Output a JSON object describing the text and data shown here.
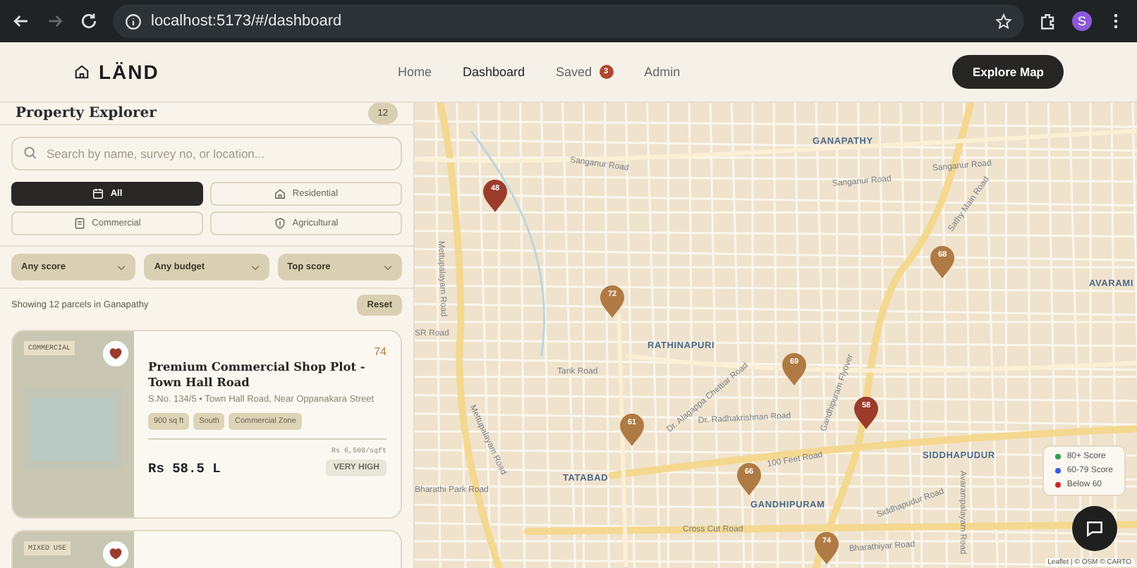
{
  "browser": {
    "url": "localhost:5173/#/dashboard",
    "forward_disabled": true,
    "profile_initial": "S"
  },
  "navbar": {
    "brand": "LÄND",
    "links": [
      {
        "label": "Home",
        "selected": false
      },
      {
        "label": "Dashboard",
        "selected": true
      },
      {
        "label": "Saved",
        "selected": false,
        "badge": "3"
      },
      {
        "label": "Admin",
        "selected": false
      }
    ],
    "cta": "Explore Map"
  },
  "sidebar": {
    "title": "Property Explorer",
    "count": "12",
    "search": {
      "placeholder": "Search by name, survey no, or location..."
    },
    "type_filters": [
      {
        "label": "All",
        "selected": true
      },
      {
        "label": "Residential",
        "selected": false
      },
      {
        "label": "Commercial",
        "selected": false
      },
      {
        "label": "Agricultural",
        "selected": false
      }
    ],
    "dropdowns": [
      "Any score",
      "Any budget",
      "Top score"
    ],
    "summary": "Showing 12 parcels in Ganapathy",
    "reset": "Reset",
    "cards": [
      {
        "tag": "COMMERCIAL",
        "saved": true,
        "score": "74",
        "title": "Premium Commercial Shop Plot - Town Hall Road",
        "address": "S.No. 134/5 • Town Hall Road, Near Oppanakara Street",
        "chips": [
          "900 sq ft",
          "South",
          "Commercial Zone"
        ],
        "rate": "Rs 6,500/sqft",
        "price": "Rs 58.5 L",
        "demand": "VERY HIGH"
      },
      {
        "tag": "MIXED USE",
        "saved": true
      }
    ]
  },
  "map": {
    "labels": [
      {
        "text": "GANAPATHY",
        "kind": "area"
      },
      {
        "text": "Sanganur Road",
        "kind": "road"
      },
      {
        "text": "Sanganur Road",
        "kind": "road"
      },
      {
        "text": "Sanganur Road",
        "kind": "road"
      },
      {
        "text": "Mettupalayam Road",
        "kind": "road"
      },
      {
        "text": "Sathy Main Road",
        "kind": "road"
      },
      {
        "text": "AVARAMI",
        "kind": "area"
      },
      {
        "text": "SR Road",
        "kind": "road"
      },
      {
        "text": "RATHINAPURI",
        "kind": "area"
      },
      {
        "text": "Tank Road",
        "kind": "road"
      },
      {
        "text": "Dr. Alagappa Chettiar Road",
        "kind": "road"
      },
      {
        "text": "Dr. Radhakrishnan Road",
        "kind": "road"
      },
      {
        "text": "Mettupalayam Road",
        "kind": "road"
      },
      {
        "text": "Bharathi Park Road",
        "kind": "road"
      },
      {
        "text": "TATABAD",
        "kind": "area"
      },
      {
        "text": "100 Feet Road",
        "kind": "road"
      },
      {
        "text": "GANDHIPURAM",
        "kind": "area"
      },
      {
        "text": "Gandhipuram Flyover",
        "kind": "road"
      },
      {
        "text": "SIDDHAPUDUR",
        "kind": "area"
      },
      {
        "text": "Siddhapudur Road",
        "kind": "road"
      },
      {
        "text": "Avarampalayam Road",
        "kind": "road"
      },
      {
        "text": "Cross Cut Road",
        "kind": "road"
      },
      {
        "text": "Bharathiyar Road",
        "kind": "road"
      }
    ],
    "markers": [
      {
        "score": "48",
        "color": "#9b3b2b"
      },
      {
        "score": "72",
        "color": "#b07a45"
      },
      {
        "score": "68",
        "color": "#b07a45"
      },
      {
        "score": "69",
        "color": "#b07a45"
      },
      {
        "score": "58",
        "color": "#9b3b2b"
      },
      {
        "score": "61",
        "color": "#b07a45"
      },
      {
        "score": "66",
        "color": "#b07a45"
      },
      {
        "score": "74",
        "color": "#b07a45"
      }
    ],
    "legend": [
      {
        "label": "80+ Score",
        "color": "#2e9e4f"
      },
      {
        "label": "60-79 Score",
        "color": "#3b5bdb"
      },
      {
        "label": "Below 60",
        "color": "#c92a2a"
      }
    ],
    "attribution": "Leaflet | © OSM © CARTO"
  }
}
